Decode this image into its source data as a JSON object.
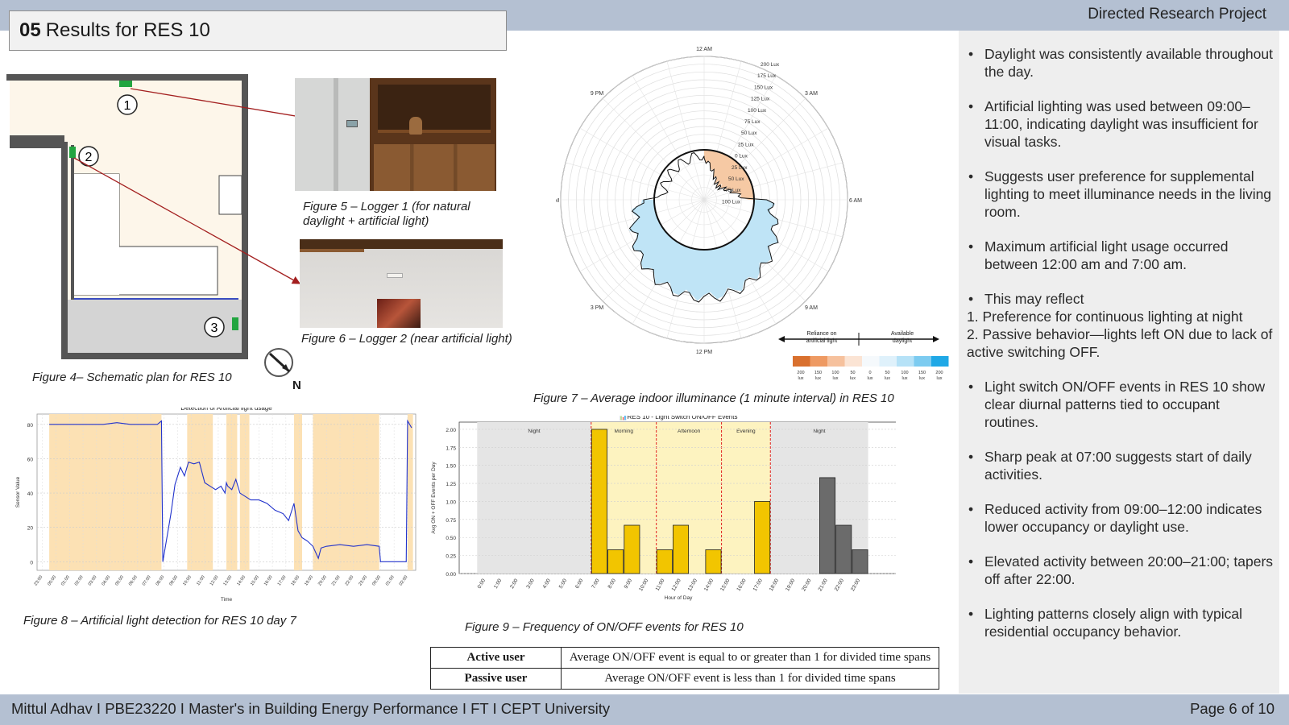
{
  "header": {
    "number": "05",
    "title": "Results for RES 10",
    "project": "Directed Research Project"
  },
  "plan": {
    "caption": "Figure 4– Schematic plan for RES 10",
    "markers": [
      "1",
      "2",
      "3"
    ],
    "north": "N"
  },
  "logger1": {
    "caption": "Figure 5 – Logger 1 (for natural daylight + artificial light)"
  },
  "logger2": {
    "caption": "Figure 6 – Logger 2 (near artificial light)"
  },
  "polar": {
    "caption": "Figure 7 – Average indoor illuminance (1 minute interval) in RES 10",
    "hour_labels": [
      "12 AM",
      "3 AM",
      "6 AM",
      "9 AM",
      "12 PM",
      "3 PM",
      "6 PM",
      "9 PM"
    ],
    "ring_labels": [
      "200 Lux",
      "175 Lux",
      "150 Lux",
      "125 Lux",
      "100 Lux",
      "75 Lux",
      "50 Lux",
      "25 Lux",
      "0 Lux",
      "25 Lux",
      "50 Lux",
      "75 Lux",
      "100 Lux"
    ],
    "legend_left": "Reliance on artificial light",
    "legend_right": "Available daylight",
    "scale_labels": [
      "200 lux",
      "150 lux",
      "100 lux",
      "50 lux",
      "0 lux",
      "50 lux",
      "100 lux",
      "150 lux",
      "200 lux"
    ],
    "scale_colors": [
      "#d9702e",
      "#ee9a63",
      "#f6c19d",
      "#fbe4d4",
      "#f5f9fc",
      "#dff1fb",
      "#b6e2f7",
      "#7ccbf0",
      "#1fa8e6"
    ]
  },
  "colors": {
    "band": "#b4c0d2",
    "panel": "#eeeeee",
    "artificial": "#f6c9a4",
    "daylight": "#bfe4f6",
    "bar": "#f2c500",
    "bar_night": "#6b6b6b",
    "zone_night": "#e5e5e5",
    "zone_day": "#fdf3c0",
    "shade": "#fce1b4",
    "arrow": "#a31f1f"
  },
  "chart_data": [
    {
      "type": "line",
      "title": "Detection of Artificial light usage",
      "xlabel": "Time",
      "ylabel": "Sensor Value",
      "ylim": [
        -5,
        86
      ],
      "yticks": [
        0,
        20,
        40,
        60,
        80
      ],
      "x_ticks": [
        "23:00",
        "00:00",
        "01:00",
        "02:00",
        "03:00",
        "04:00",
        "05:00",
        "06:00",
        "07:00",
        "08:00",
        "09:00",
        "10:00",
        "11:00",
        "12:00",
        "13:00",
        "14:00",
        "15:00",
        "16:00",
        "17:00",
        "18:00",
        "19:00",
        "20:00",
        "21:00",
        "22:00",
        "23:00",
        "00:00",
        "01:00",
        "02:00"
      ],
      "shaded_spans": [
        [
          23.5,
          31.8
        ],
        [
          33.7,
          35.6
        ],
        [
          36.6,
          37.4
        ],
        [
          37.6,
          38.3
        ],
        [
          41.6,
          42.2
        ],
        [
          43.0,
          47.9
        ],
        [
          50.0,
          50.4
        ]
      ],
      "series": [
        {
          "x": [
            23.5,
            24.5,
            25.5,
            26.5,
            27.5,
            28.5,
            29.5,
            30.5,
            31.5,
            31.8,
            31.9,
            32.5,
            32.8,
            33.2,
            33.5,
            33.8,
            34.2,
            34.6,
            35.0,
            35.4,
            35.8,
            36.2,
            36.5,
            36.6,
            36.7,
            37.0,
            37.3,
            37.6,
            38.0,
            38.4,
            39.0,
            39.6,
            40.2,
            40.8,
            41.2,
            41.6,
            41.9,
            42.2,
            42.6,
            43.0,
            43.4,
            43.6,
            44.0,
            45.0,
            46.0,
            47.0,
            47.9,
            48.0,
            49.9,
            50.0,
            50.3
          ],
          "y": [
            80,
            80,
            80,
            80,
            80,
            81,
            80,
            80,
            80,
            82,
            0,
            28,
            45,
            55,
            50,
            58,
            57,
            58,
            46,
            44,
            42,
            44,
            40,
            46,
            44,
            42,
            48,
            40,
            38,
            36,
            36,
            34,
            30,
            28,
            24,
            34,
            18,
            14,
            12,
            9,
            2,
            8,
            9,
            10,
            9,
            10,
            9,
            0,
            0,
            82,
            78
          ]
        }
      ]
    },
    {
      "type": "bar",
      "title": "📊RES 10 - Light Switch ON/OFF Events",
      "xlabel": "Hour of Day",
      "ylabel": "Avg ON + OFF Events per Day",
      "ylim": [
        0,
        2.1
      ],
      "yticks": [
        "0.00",
        "0.25",
        "0.50",
        "0.75",
        "1.00",
        "1.25",
        "1.50",
        "1.75",
        "2.00"
      ],
      "categories": [
        "0:00",
        "1:00",
        "2:00",
        "3:00",
        "4:00",
        "5:00",
        "6:00",
        "7:00",
        "8:00",
        "9:00",
        "10:00",
        "11:00",
        "12:00",
        "13:00",
        "14:00",
        "15:00",
        "16:00",
        "17:00",
        "18:00",
        "19:00",
        "20:00",
        "21:00",
        "22:00",
        "23:00"
      ],
      "values": [
        0,
        0,
        0,
        0,
        0,
        0,
        0,
        2.0,
        0.33,
        0.67,
        0,
        0.33,
        0.67,
        0,
        0.33,
        0,
        0,
        1.0,
        0,
        0,
        0,
        1.33,
        0.67,
        0.33
      ],
      "zones": [
        {
          "label": "Night",
          "start": 0,
          "end": 7
        },
        {
          "label": "Morning",
          "start": 7,
          "end": 11
        },
        {
          "label": "Afternoon",
          "start": 11,
          "end": 15
        },
        {
          "label": "Evening",
          "start": 15,
          "end": 18
        },
        {
          "label": "Night",
          "start": 18,
          "end": 24
        }
      ]
    }
  ],
  "chart8_caption": "Figure 8 – Artificial light detection for RES 10 day 7",
  "chart9_caption": "Figure 9 – Frequency of ON/OFF events for RES 10",
  "legend_table": [
    {
      "key": "Active user",
      "desc": "Average ON/OFF event is equal to or greater than 1 for divided time spans"
    },
    {
      "key": "Passive user",
      "desc": "Average ON/OFF event is less than 1 for divided time spans"
    }
  ],
  "bullets": [
    "Daylight was consistently available throughout the day.",
    "Artificial lighting was used between 09:00–11:00, indicating daylight was insufficient for visual tasks.",
    "Suggests user preference for supplemental lighting to meet illuminance needs in the living room.",
    "Maximum artificial light usage occurred between 12:00 am and 7:00 am.",
    "Light switch ON/OFF events in RES 10 show clear diurnal patterns tied to occupant routines.",
    "Sharp peak at 07:00 suggests start of daily activities.",
    "Reduced activity from 09:00–12:00 indicates lower occupancy or daylight use.",
    "Elevated activity between 20:00–21:00; tapers off after 22:00.",
    "Lighting patterns closely align with typical residential occupancy behavior."
  ],
  "reflect": {
    "head": "This may reflect",
    "line1": "1. Preference for continuous lighting at night",
    "line2": "2. Passive behavior—lights left ON due to lack of active switching OFF."
  },
  "footer": {
    "left": "Mittul Adhav I PBE23220 I Master's in Building Energy Performance I FT I CEPT University",
    "right": "Page 6 of 10"
  }
}
